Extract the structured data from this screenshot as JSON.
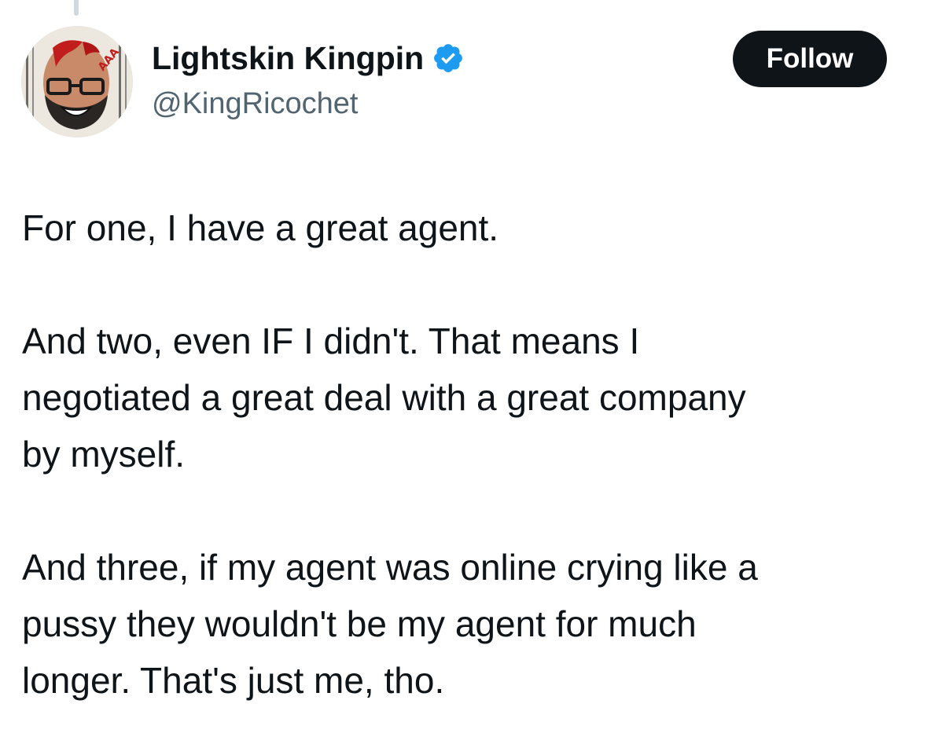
{
  "author": {
    "display_name": "Lightskin Kingpin",
    "handle": "@KingRicochet",
    "verified": true,
    "avatar_icon": "profile-avatar",
    "verified_icon": "verified-badge-icon",
    "verified_color": "#1d9bf0"
  },
  "follow_button": {
    "label": "Follow",
    "background": "#0f1419"
  },
  "tweet": {
    "paragraphs": [
      "For one, I have a great agent.",
      "And two, even IF I didn't. That means I\nnegotiated a great deal with a great company\nby myself.",
      "And three, if my agent was online crying like a\npussy they wouldn't be my agent for much\nlonger. That's just me, tho."
    ]
  }
}
